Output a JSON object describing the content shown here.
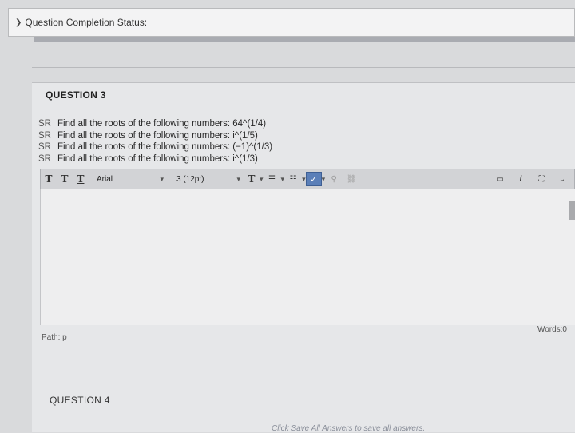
{
  "status": {
    "label": "Question Completion Status:",
    "caret_icon": "chevron-down-icon"
  },
  "question3": {
    "title": "QUESTION 3",
    "lines": [
      {
        "tag": "SR",
        "text": "Find all the roots of the following numbers:  64^(1/4)"
      },
      {
        "tag": "SR",
        "text": "Find all the roots of the following numbers:   i^(1/5)"
      },
      {
        "tag": "SR",
        "text": "Find all the roots of the following numbers:   (−1)^(1/3)"
      },
      {
        "tag": "SR",
        "text": "Find all the roots of the following numbers:   i^(1/3)"
      }
    ]
  },
  "toolbar": {
    "t1": "T",
    "t2": "T",
    "t3": "T",
    "font": "Arial",
    "size": "3 (12pt)",
    "color_t": "T",
    "list1": "☰",
    "list2": "☷",
    "check": "✓",
    "link1": "⚲",
    "link2": "⛓",
    "right1": "▭",
    "right2": "i",
    "right3": "⛶",
    "right4": "⌄"
  },
  "editor": {
    "words": "Words:0",
    "path": "Path: p"
  },
  "question4": {
    "title": "QUESTION 4"
  },
  "footer": {
    "hint": "Click Save All Answers to save all answers."
  }
}
